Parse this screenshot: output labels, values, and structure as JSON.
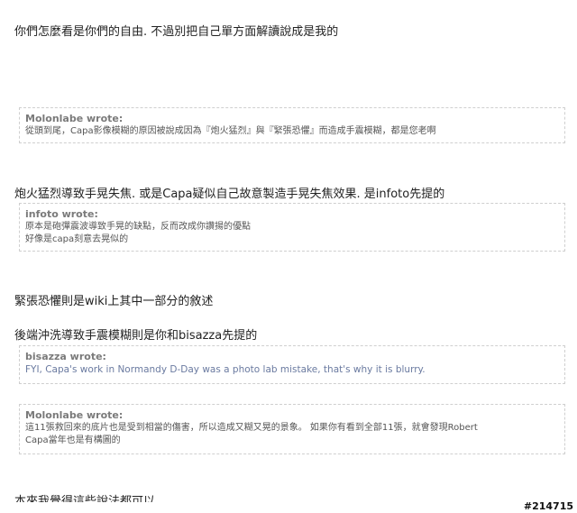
{
  "paragraphs": {
    "p1": "你們怎麼看是你們的自由. 不過別把自己單方面解讀說成是我的",
    "p2": "炮火猛烈導致手晃失焦. 或是Capa疑似自己故意製造手晃失焦效果. 是infoto先提的",
    "p3": "緊張恐懼則是wiki上其中一部分的敘述",
    "p4": "後端沖洗導致手震模糊則是你和bisazza先提的",
    "p5_cut": "本來我覺得這些說法都可以"
  },
  "quotes": [
    {
      "author": "Molonlabe wrote:",
      "lines": [
        "從頭到尾，Capa影像模糊的原因被說成因為『炮火猛烈』與『緊張恐懼』而造成手震模糊，都是您老啊"
      ]
    },
    {
      "author": "infoto wrote:",
      "lines": [
        "原本是砲彈震波導致手晃的缺點，反而改成你讚揚的優點",
        "好像是capa刻意去晃似的"
      ]
    },
    {
      "author": "bisazza wrote:",
      "lines": [
        "FYI, Capa's work in Normandy D-Day was a photo lab mistake, that's why it is blurry."
      ]
    },
    {
      "author": "Molonlabe wrote:",
      "lines": [
        "這11張救回來的底片也是受到相當的傷害，所以造成又糊又晃的景象。 如果你有看到全部11張，就會發現Robert",
        "Capa當年也是有構圖的"
      ]
    }
  ],
  "watermark": "#214715"
}
